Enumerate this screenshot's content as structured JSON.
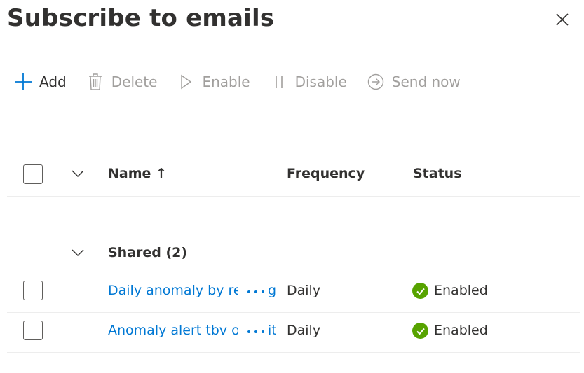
{
  "panel": {
    "title": "Subscribe to emails"
  },
  "toolbar": {
    "add_label": "Add",
    "delete_label": "Delete",
    "enable_label": "Enable",
    "disable_label": "Disable",
    "send_now_label": "Send now"
  },
  "table": {
    "headers": {
      "name": "Name ↑",
      "frequency": "Frequency",
      "status": "Status"
    },
    "group": {
      "label": "Shared (2)"
    },
    "rows": [
      {
        "name": "Daily anomaly by resource group",
        "trail": "g",
        "frequency": "Daily",
        "status": "Enabled"
      },
      {
        "name": "Anomaly alert tbv optimization alert",
        "trail": "it",
        "frequency": "Daily",
        "status": "Enabled"
      }
    ]
  },
  "colors": {
    "accent": "#0078d4",
    "status_ok": "#57a300",
    "disabled_text": "#a19f9d"
  }
}
